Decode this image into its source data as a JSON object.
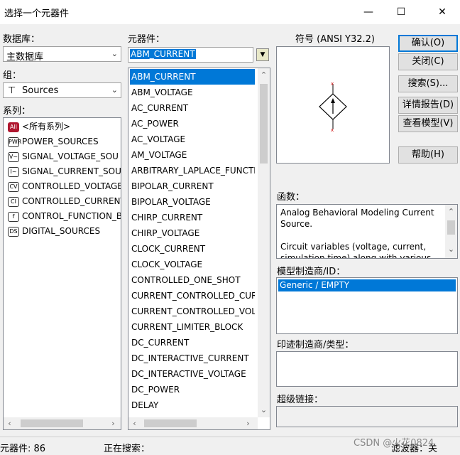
{
  "window": {
    "title": "选择一个元器件",
    "minimize": "—",
    "maximize": "☐",
    "close": "✕"
  },
  "labels": {
    "database": "数据库：",
    "group": "组：",
    "family": "系列：",
    "component": "元器件：",
    "symbol": "符号 (ANSI Y32.2)",
    "function": "函数：",
    "model_manufacturer": "模型制造商/ID：",
    "footprint_manufacturer": "印迹制造商/类型：",
    "hyperlink": "超级链接："
  },
  "database_select": {
    "value": "主数据库"
  },
  "group_select": {
    "value": "Sources"
  },
  "component_input": {
    "value": "ABM_CURRENT"
  },
  "families": [
    {
      "icon": "All",
      "label": "<所有系列>",
      "selected": true
    },
    {
      "icon": "PWR",
      "label": "POWER_SOURCES"
    },
    {
      "icon": "V~",
      "label": "SIGNAL_VOLTAGE_SOU"
    },
    {
      "icon": "I~",
      "label": "SIGNAL_CURRENT_SOU"
    },
    {
      "icon": "CV",
      "label": "CONTROLLED_VOLTAGE"
    },
    {
      "icon": "CI",
      "label": "CONTROLLED_CURRENT"
    },
    {
      "icon": "f",
      "label": "CONTROL_FUNCTION_B"
    },
    {
      "icon": "DS",
      "label": "DIGITAL_SOURCES"
    }
  ],
  "components": [
    "ABM_CURRENT",
    "ABM_VOLTAGE",
    "AC_CURRENT",
    "AC_POWER",
    "AC_VOLTAGE",
    "AM_VOLTAGE",
    "ARBITRARY_LAPLACE_FUNCTI",
    "BIPOLAR_CURRENT",
    "BIPOLAR_VOLTAGE",
    "CHIRP_CURRENT",
    "CHIRP_VOLTAGE",
    "CLOCK_CURRENT",
    "CLOCK_VOLTAGE",
    "CONTROLLED_ONE_SHOT",
    "CURRENT_CONTROLLED_CURR",
    "CURRENT_CONTROLLED_VOLT",
    "CURRENT_LIMITER_BLOCK",
    "DC_CURRENT",
    "DC_INTERACTIVE_CURRENT",
    "DC_INTERACTIVE_VOLTAGE",
    "DC_POWER",
    "DELAY"
  ],
  "buttons": {
    "ok": "确认(O)",
    "close": "关闭(C)",
    "search": "搜索(S)...",
    "detail_report": "详情报告(D)",
    "view_model": "查看模型(V)",
    "help": "帮助(H)"
  },
  "function_text": "Analog Behavioral Modeling Current Source.\n\nCircuit variables (voltage, current, simulation time) along with various",
  "model_manufacturers": [
    "Generic / EMPTY"
  ],
  "status": {
    "component_count": "元器件:  86",
    "searching": "正在搜索：",
    "filter": "滤波器：关"
  },
  "watermark": "CSDN @火花0824",
  "colors": {
    "selection": "#0078d7",
    "symbol_red": "#cc0000"
  }
}
